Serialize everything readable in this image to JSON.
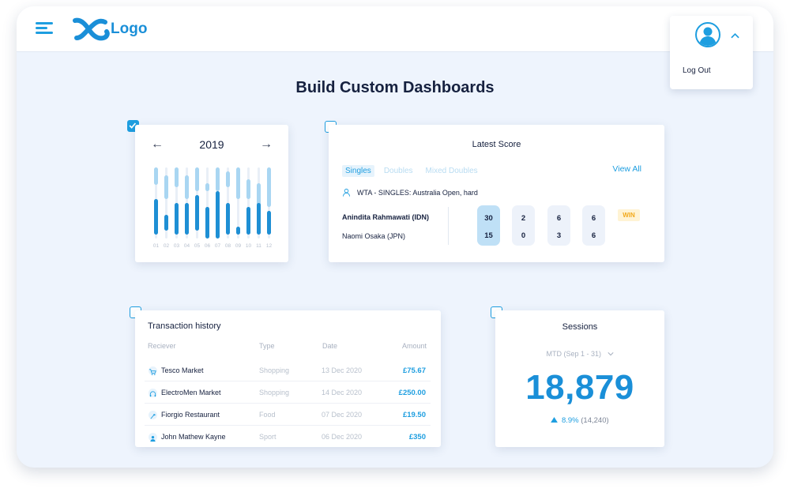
{
  "header": {
    "logo_text": "Logo",
    "menu_icon": "hamburger-icon",
    "logo_icon": "swirl-logo-icon",
    "user_menu": {
      "avatar_icon": "user-avatar-icon",
      "toggle_icon": "chevron-up-icon",
      "logout_label": "Log Out"
    }
  },
  "page": {
    "title": "Build Custom Dashboards"
  },
  "colors": {
    "accent": "#1e9ee0",
    "background": "#eef4fd",
    "win": "#f2a91b"
  },
  "calendar_widget": {
    "checked": true,
    "prev_icon": "arrow-left-icon",
    "next_icon": "arrow-right-icon",
    "year": "2019",
    "month_labels": [
      "01",
      "02",
      "03",
      "04",
      "05",
      "06",
      "07",
      "08",
      "09",
      "10",
      "11",
      "12"
    ]
  },
  "score_widget": {
    "checked": false,
    "title": "Latest Score",
    "tabs": [
      "Singles",
      "Doubles",
      "Mixed Doubles"
    ],
    "active_tab": "Singles",
    "view_all_label": "View All",
    "tournament_icon": "person-icon",
    "tournament": "WTA - SINGLES: Australia Open, hard",
    "player1": "Anindita Rahmawati (IDN)",
    "player2": "Naomi Osaka (JPN)",
    "sets": [
      {
        "p1": "30",
        "p2": "15"
      },
      {
        "p1": "2",
        "p2": "0"
      },
      {
        "p1": "6",
        "p2": "3"
      },
      {
        "p1": "6",
        "p2": "6"
      }
    ],
    "result_badge": "WIN"
  },
  "transactions_widget": {
    "checked": false,
    "title": "Transaction history",
    "columns": [
      "Reciever",
      "Type",
      "Date",
      "Amount"
    ],
    "rows": [
      {
        "icon": "cart-icon",
        "receiver": "Tesco Market",
        "type": "Shopping",
        "date": "13 Dec 2020",
        "amount": "£75.67"
      },
      {
        "icon": "headphones-icon",
        "receiver": "ElectroMen Market",
        "type": "Shopping",
        "date": "14 Dec 2020",
        "amount": "£250.00"
      },
      {
        "icon": "food-icon",
        "receiver": "Fiorgio Restaurant",
        "type": "Food",
        "date": "07 Dec 2020",
        "amount": "£19.50"
      },
      {
        "icon": "person-icon",
        "receiver": "John Mathew Kayne",
        "type": "Sport",
        "date": "06 Dec 2020",
        "amount": "£350"
      }
    ]
  },
  "sessions_widget": {
    "checked": false,
    "title": "Sessions",
    "period": "MTD (Sep 1 - 31)",
    "dropdown_icon": "chevron-down-icon",
    "value": "18,879",
    "trend_icon": "triangle-up-icon",
    "change_pct": "8.9%",
    "previous": "(14,240)"
  }
}
